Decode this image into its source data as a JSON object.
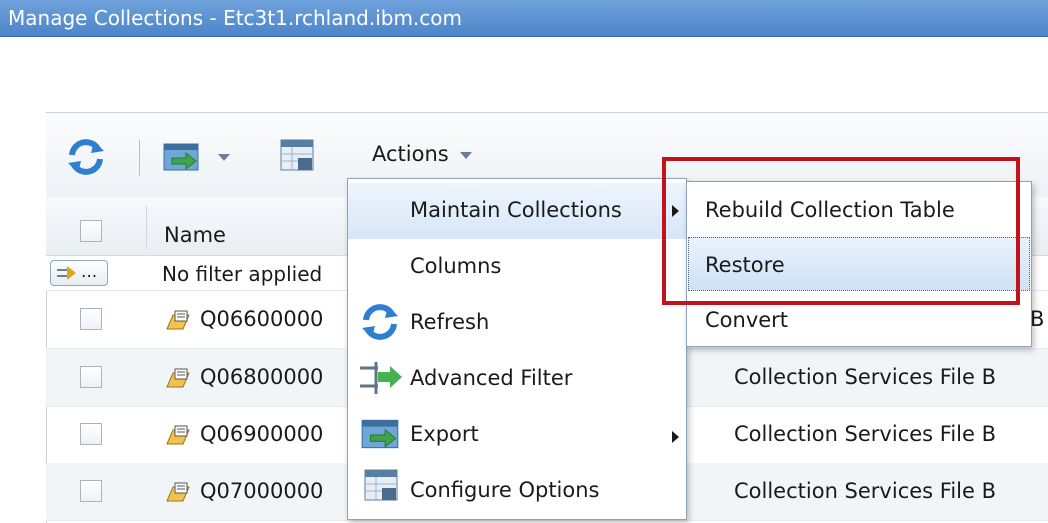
{
  "window": {
    "title": "Manage Collections - Etc3t1.rchland.ibm.com"
  },
  "toolbar": {
    "refresh_icon": "refresh-icon",
    "export_icon": "export-icon",
    "configure_icon": "configure-options-icon",
    "actions_label": "Actions"
  },
  "table": {
    "columns": {
      "name": "Name"
    },
    "filter": {
      "button": "...",
      "text": "No filter applied"
    },
    "rows": [
      {
        "name": "Q06600000",
        "desc": "B"
      },
      {
        "name": "Q06800000",
        "desc": "Collection Services File B"
      },
      {
        "name": "Q06900000",
        "desc": "Collection Services File B"
      },
      {
        "name": "Q07000000",
        "desc": "Collection Services File B"
      }
    ]
  },
  "actions_menu": {
    "items": [
      {
        "label": "Maintain Collections",
        "icon": "",
        "has_submenu": true,
        "highlighted": true
      },
      {
        "label": "Columns",
        "icon": ""
      },
      {
        "label": "Refresh",
        "icon": "refresh-icon"
      },
      {
        "label": "Advanced Filter",
        "icon": "advanced-filter-icon"
      },
      {
        "label": "Export",
        "icon": "export-icon",
        "has_submenu": true
      },
      {
        "label": "Configure Options",
        "icon": "configure-options-icon"
      }
    ]
  },
  "submenu": {
    "items": [
      {
        "label": "Rebuild Collection Table"
      },
      {
        "label": "Restore",
        "highlighted": true
      },
      {
        "label": "Convert"
      }
    ]
  },
  "colors": {
    "highlight_box": "#c0131b",
    "title_bar": "#5b8fd1"
  }
}
